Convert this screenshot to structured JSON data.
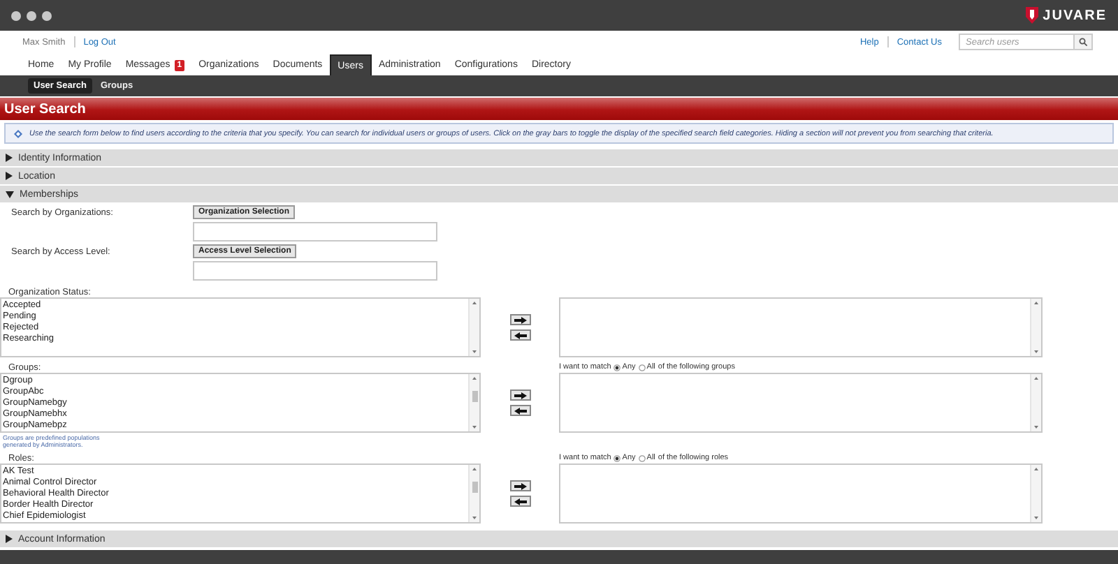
{
  "window": {
    "brand": "JUVARE"
  },
  "header": {
    "user_name": "Max Smith",
    "logout": "Log Out",
    "links": [
      "Help",
      "Contact Us"
    ],
    "search": {
      "placeholder": "Search users"
    }
  },
  "nav": {
    "tabs": [
      {
        "label": "Home",
        "selected": false
      },
      {
        "label": "My Profile",
        "selected": false
      },
      {
        "label": "Messages",
        "selected": false,
        "badge": "1"
      },
      {
        "label": "Organizations",
        "selected": false
      },
      {
        "label": "Documents",
        "selected": false
      },
      {
        "label": "Users",
        "selected": true
      },
      {
        "label": "Administration",
        "selected": false
      },
      {
        "label": "Configurations",
        "selected": false
      },
      {
        "label": "Directory",
        "selected": false
      }
    ]
  },
  "subnav": [
    {
      "label": "User Search",
      "selected": true
    },
    {
      "label": "Groups",
      "selected": false
    }
  ],
  "page_title": "User Search",
  "info_text": "Use the search form below to find users according to the criteria that you specify. You can search for individual users or groups of users. Click on the gray bars to toggle the display of the specified search field categories. Hiding a section will not prevent you from searching that criteria.",
  "sections": [
    {
      "title": "Identity Information",
      "expanded": false
    },
    {
      "title": "Location",
      "expanded": false
    },
    {
      "title": "Memberships",
      "expanded": true,
      "body": {
        "pickers": [
          {
            "label": "Search by Organizations:",
            "button": "Organization Selection"
          },
          {
            "label": "Search by Access Level:",
            "button": "Access Level Selection"
          }
        ],
        "lists": [
          {
            "label": "Organization Status:",
            "options": [
              "Accepted",
              "Pending",
              "Rejected",
              "Researching"
            ]
          },
          {
            "label": "Groups:",
            "options": [
              "Dgroup",
              "GroupAbc",
              "GroupNamebgy",
              "GroupNamebhx",
              "GroupNamebpz"
            ],
            "note": "Groups are predefined populations generated by Administrators.",
            "match": {
              "prefix": "I want to match",
              "options": [
                {
                  "label": "Any",
                  "selected": true
                },
                {
                  "label": "All",
                  "selected": false
                }
              ],
              "suffix": "of the following groups"
            }
          },
          {
            "label": "Roles:",
            "options": [
              "AK Test",
              "Animal Control Director",
              "Behavioral Health Director",
              "Border Health Director",
              "Chief Epidemiologist"
            ],
            "match": {
              "prefix": "I want to match",
              "options": [
                {
                  "label": "Any",
                  "selected": true
                },
                {
                  "label": "All",
                  "selected": false
                }
              ],
              "suffix": "of the following roles"
            }
          }
        ]
      }
    },
    {
      "title": "Account Information",
      "expanded": false
    }
  ]
}
